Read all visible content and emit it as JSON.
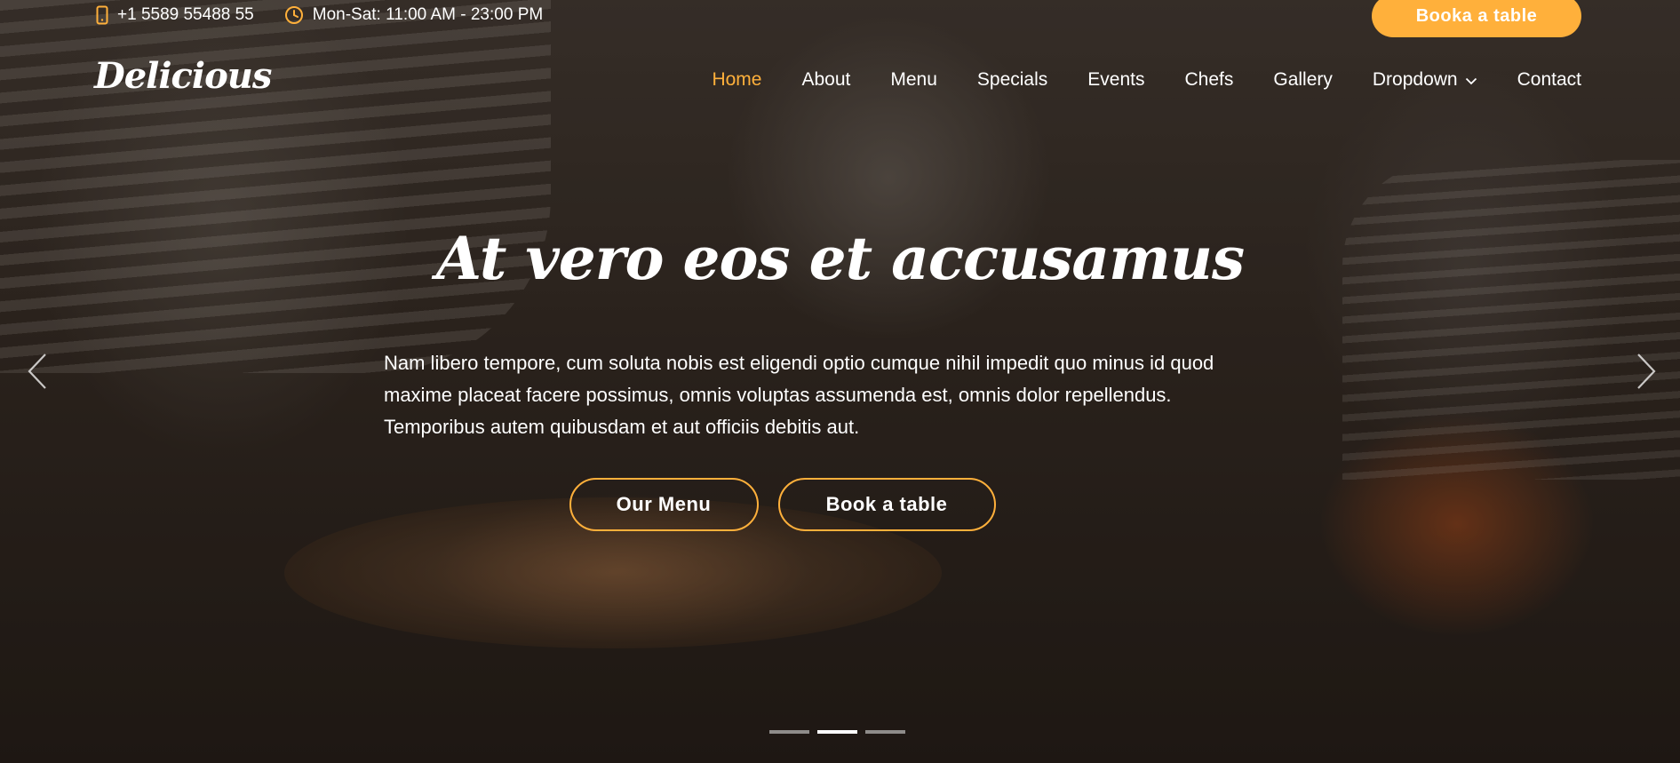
{
  "topbar": {
    "phone": "+1 5589 55488 55",
    "hours": "Mon-Sat: 11:00 AM - 23:00 PM",
    "book_label": "Booka a table"
  },
  "header": {
    "logo": "Delicious",
    "nav": [
      {
        "label": "Home",
        "active": true
      },
      {
        "label": "About"
      },
      {
        "label": "Menu"
      },
      {
        "label": "Specials"
      },
      {
        "label": "Events"
      },
      {
        "label": "Chefs"
      },
      {
        "label": "Gallery"
      },
      {
        "label": "Dropdown",
        "has_dropdown": true
      },
      {
        "label": "Contact"
      }
    ]
  },
  "hero": {
    "title": "At vero eos et accusamus",
    "description": "Nam libero tempore, cum soluta nobis est eligendi optio cumque nihil impedit quo minus id quod maxime placeat facere possimus, omnis voluptas assumenda est, omnis dolor repellendus. Temporibus autem quibusdam et aut officiis debitis aut.",
    "menu_button": "Our Menu",
    "book_button": "Book a table"
  },
  "carousel": {
    "slide_count": 3,
    "active_index": 1
  },
  "colors": {
    "accent": "#ffb03b",
    "text": "#ffffff"
  },
  "icons": {
    "phone": "phone-icon",
    "clock": "clock-icon",
    "prev": "chevron-left-icon",
    "next": "chevron-right-icon",
    "dropdown": "chevron-down-icon"
  }
}
